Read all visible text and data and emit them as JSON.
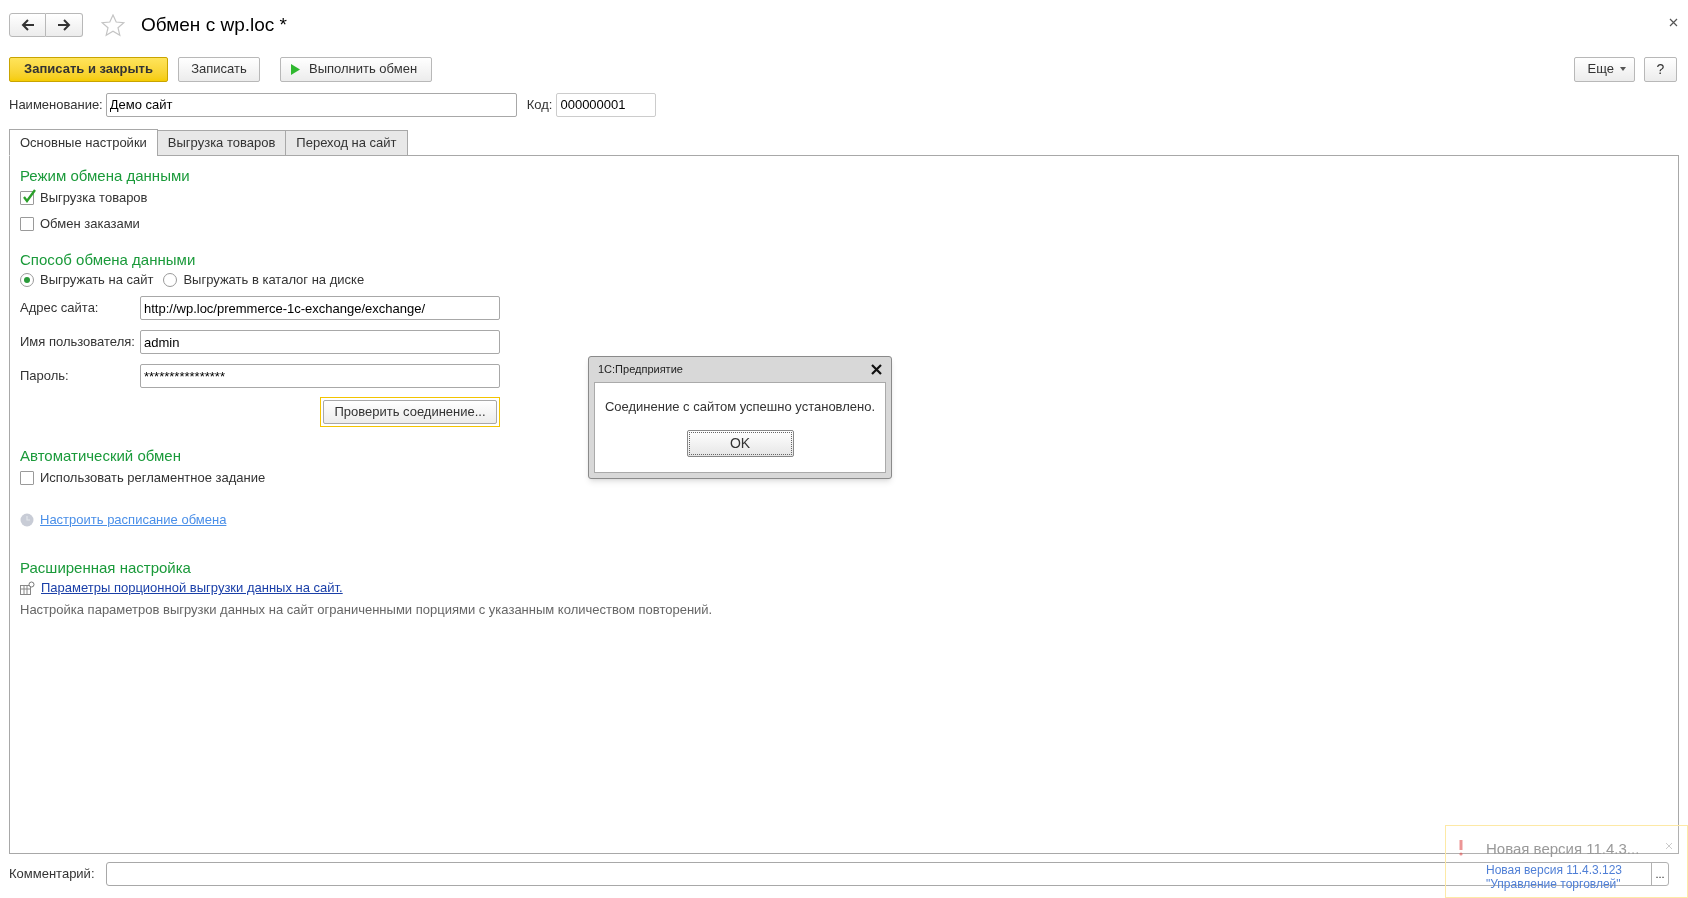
{
  "title": "Обмен с wp.loc *",
  "toolbar": [
    {
      "label": "Записать и закрыть",
      "kind": "primary"
    },
    {
      "label": "Записать",
      "kind": "plain"
    },
    {
      "label": "Выполнить обмен",
      "kind": "run"
    }
  ],
  "toolbar_right": [
    {
      "label": "Еще",
      "kind": "menu"
    },
    {
      "label": "?",
      "kind": "plain"
    }
  ],
  "header_fields": [
    {
      "label": "Наименование:",
      "value": "Демо сайт"
    },
    {
      "label": "Код:",
      "value": "000000001"
    }
  ],
  "tabs": [
    {
      "label": "Основные настройки",
      "selected": true
    },
    {
      "label": "Выгрузка товаров",
      "selected": false
    },
    {
      "label": "Переход на сайт",
      "selected": false
    }
  ],
  "sections": [
    {
      "heading": "Режим обмена данными",
      "items": [
        {
          "kind": "checkbox",
          "label": "Выгрузка товаров",
          "checked": true
        },
        {
          "kind": "checkbox",
          "label": "Обмен заказами",
          "checked": false
        }
      ]
    },
    {
      "heading": "Способ обмена данными",
      "items": [
        {
          "kind": "radios",
          "options": [
            {
              "label": "Выгружать на сайт",
              "selected": true
            },
            {
              "label": "Выгружать в каталог на диске",
              "selected": false
            }
          ]
        },
        {
          "kind": "field",
          "label": "Адрес сайта:",
          "value": "http://wp.loc/premmerce-1c-exchange/exchange/"
        },
        {
          "kind": "field",
          "label": "Имя пользователя:",
          "value": "admin"
        },
        {
          "kind": "field",
          "label": "Пароль:",
          "value": "****************"
        },
        {
          "kind": "button",
          "label": "Проверить соединение..."
        }
      ]
    },
    {
      "heading": "Автоматический обмен",
      "items": [
        {
          "kind": "checkbox",
          "label": "Использовать регламентное задание",
          "checked": false
        },
        {
          "kind": "schedule_link",
          "label": "Настроить расписание обмена"
        }
      ]
    },
    {
      "heading": "Расширенная настройка",
      "items": [
        {
          "kind": "settings_link",
          "label": "Параметры порционной выгрузки данных на сайт."
        },
        {
          "kind": "note",
          "text": "Настройка параметров выгрузки данных на сайт ограниченными порциями с указанным количеством повторений."
        }
      ]
    }
  ],
  "comment": {
    "label": "Комментарий:",
    "button": "..."
  },
  "dialog": {
    "title": "1С:Предприятие",
    "message": "Соединение с сайтом успешно установлено.",
    "button": "OK"
  },
  "notification": {
    "title": "Новая версия 11.4.3...",
    "lines": [
      "Новая версия 11.4.3.123",
      "\"Управление торговлей\""
    ]
  }
}
